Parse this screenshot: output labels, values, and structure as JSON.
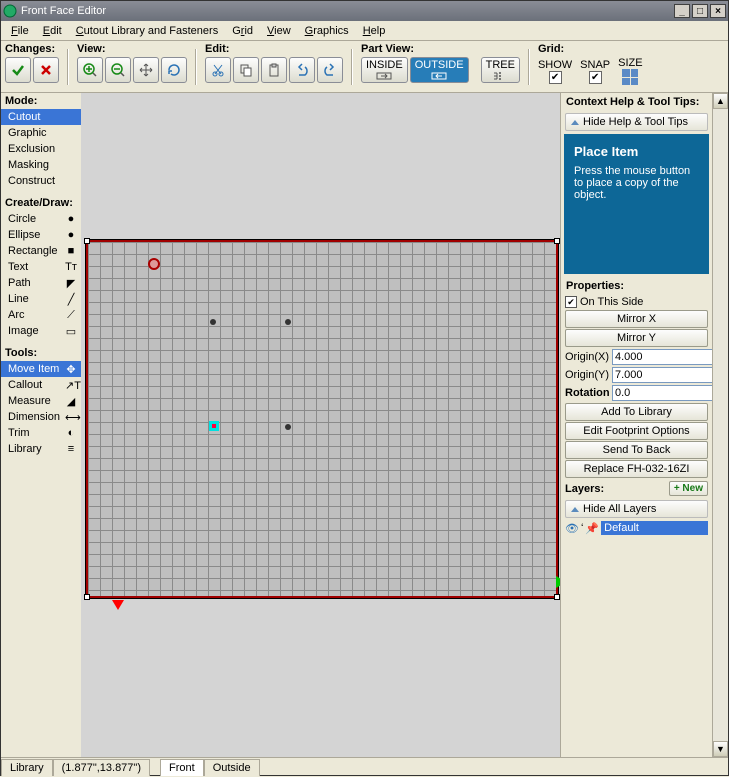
{
  "title": "Front Face Editor",
  "menu": [
    "File",
    "Edit",
    "Cutout Library and Fasteners",
    "Grid",
    "View",
    "Graphics",
    "Help"
  ],
  "toolbar": {
    "changes": "Changes:",
    "view": "View:",
    "edit": "Edit:",
    "partview": "Part View:",
    "grid": "Grid:",
    "pv_inside": "INSIDE",
    "pv_outside": "OUTSIDE",
    "pv_tree": "TREE",
    "g_show": "SHOW",
    "g_snap": "SNAP",
    "g_size": "SIZE"
  },
  "left": {
    "mode_h": "Mode:",
    "modes": [
      "Cutout",
      "Graphic",
      "Exclusion",
      "Masking",
      "Construct"
    ],
    "create_h": "Create/Draw:",
    "creates": [
      {
        "n": "Circle",
        "i": "●"
      },
      {
        "n": "Ellipse",
        "i": "●"
      },
      {
        "n": "Rectangle",
        "i": "■"
      },
      {
        "n": "Text",
        "i": "Tᴛ"
      },
      {
        "n": "Path",
        "i": "◤"
      },
      {
        "n": "Line",
        "i": "╱"
      },
      {
        "n": "Arc",
        "i": "⟋"
      },
      {
        "n": "Image",
        "i": "▭"
      }
    ],
    "tools_h": "Tools:",
    "tools": [
      {
        "n": "Move Item",
        "i": "✥"
      },
      {
        "n": "Callout",
        "i": "↗T"
      },
      {
        "n": "Measure",
        "i": "◢"
      },
      {
        "n": "Dimension",
        "i": "⟷"
      },
      {
        "n": "Trim",
        "i": "◐"
      },
      {
        "n": "Library",
        "i": "≡"
      }
    ]
  },
  "right": {
    "help_h": "Context Help & Tool Tips:",
    "hide_help": "Hide Help & Tool Tips",
    "tip_title": "Place Item",
    "tip_body": "Press the mouse button to place a copy of the object.",
    "props_h": "Properties:",
    "on_this_side": "On This Side",
    "mirror_x": "Mirror X",
    "mirror_y": "Mirror Y",
    "origin_x_l": "Origin(X)",
    "origin_x_v": "4.000",
    "origin_y_l": "Origin(Y)",
    "origin_y_v": "7.000",
    "rotation_l": "Rotation",
    "rotation_v": "0.0",
    "add_lib": "Add To Library",
    "edit_fp": "Edit Footprint Options",
    "send_back": "Send To Back",
    "replace": "Replace FH-032-16ZI",
    "layers_h": "Layers:",
    "new": "+ New",
    "hide_layers": "Hide All Layers",
    "layer_def": "Default"
  },
  "status": {
    "tab_library": "Library",
    "coords": "(1.877\",13.877\")",
    "tab_front": "Front",
    "tab_outside": "Outside"
  }
}
